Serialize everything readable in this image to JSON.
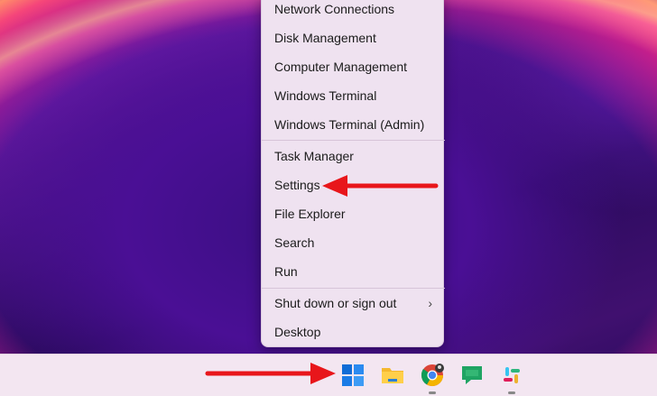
{
  "menu": {
    "items": [
      {
        "label": "Network Connections"
      },
      {
        "label": "Disk Management"
      },
      {
        "label": "Computer Management"
      },
      {
        "label": "Windows Terminal"
      },
      {
        "label": "Windows Terminal (Admin)"
      },
      {
        "label": "Task Manager"
      },
      {
        "label": "Settings"
      },
      {
        "label": "File Explorer"
      },
      {
        "label": "Search"
      },
      {
        "label": "Run"
      },
      {
        "label": "Shut down or sign out",
        "chevron": "›"
      },
      {
        "label": "Desktop"
      }
    ]
  },
  "taskbar": {
    "icons": [
      "windows-start-icon",
      "file-explorer-icon",
      "chrome-icon",
      "google-chat-icon",
      "slack-icon"
    ]
  },
  "annotations": {
    "arrow_color": "#e8161b"
  }
}
